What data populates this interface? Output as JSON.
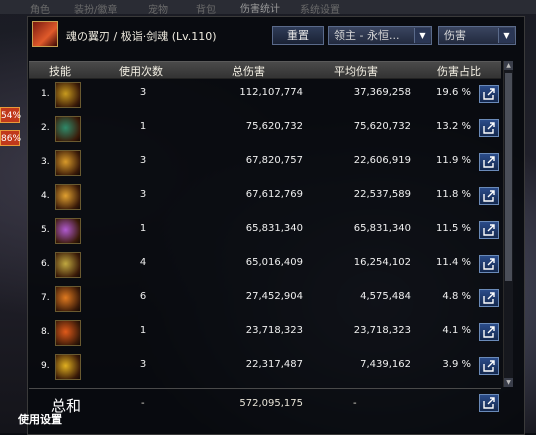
{
  "window": {
    "title": "伤害统计"
  },
  "background_tabs": [
    "角色",
    "装扮/徽章",
    "宠物",
    "背包",
    "系统设置"
  ],
  "side_badges": [
    "54%",
    "86%"
  ],
  "header": {
    "character": "魂の翼刃 / 极诣·剑魂 (Lv.110)",
    "reset_label": "重置",
    "target_select": "领主 - 永恒...",
    "metric_select": "伤害"
  },
  "columns": {
    "skill": "技能",
    "uses": "使用次数",
    "total": "总伤害",
    "avg": "平均伤害",
    "pct": "伤害占比"
  },
  "rows": [
    {
      "rank": "1.",
      "uses": "3",
      "total": "112,107,774",
      "avg": "37,369,258",
      "pct": "19.6 %"
    },
    {
      "rank": "2.",
      "uses": "1",
      "total": "75,620,732",
      "avg": "75,620,732",
      "pct": "13.2 %"
    },
    {
      "rank": "3.",
      "uses": "3",
      "total": "67,820,757",
      "avg": "22,606,919",
      "pct": "11.9 %"
    },
    {
      "rank": "4.",
      "uses": "3",
      "total": "67,612,769",
      "avg": "22,537,589",
      "pct": "11.8 %"
    },
    {
      "rank": "5.",
      "uses": "1",
      "total": "65,831,340",
      "avg": "65,831,340",
      "pct": "11.5 %"
    },
    {
      "rank": "6.",
      "uses": "4",
      "total": "65,016,409",
      "avg": "16,254,102",
      "pct": "11.4 %"
    },
    {
      "rank": "7.",
      "uses": "6",
      "total": "27,452,904",
      "avg": "4,575,484",
      "pct": "4.8 %"
    },
    {
      "rank": "8.",
      "uses": "1",
      "total": "23,718,323",
      "avg": "23,718,323",
      "pct": "4.1 %"
    },
    {
      "rank": "9.",
      "uses": "3",
      "total": "22,317,487",
      "avg": "7,439,162",
      "pct": "3.9 %"
    }
  ],
  "total": {
    "label": "总和",
    "uses": "-",
    "total": "572,095,175",
    "avg": "-"
  },
  "footer_tab": "使用设置",
  "skill_icon_colors": [
    "#c79a1e",
    "#2f8a6a",
    "#d89a2a",
    "#e0a030",
    "#b05ad0",
    "#c0a840",
    "#e07a20",
    "#e05a1a",
    "#e0b020"
  ],
  "colors": {
    "accent": "#2b4c8a",
    "header_bg": "#3f3f3f",
    "panel_bg": "#080a0e"
  }
}
